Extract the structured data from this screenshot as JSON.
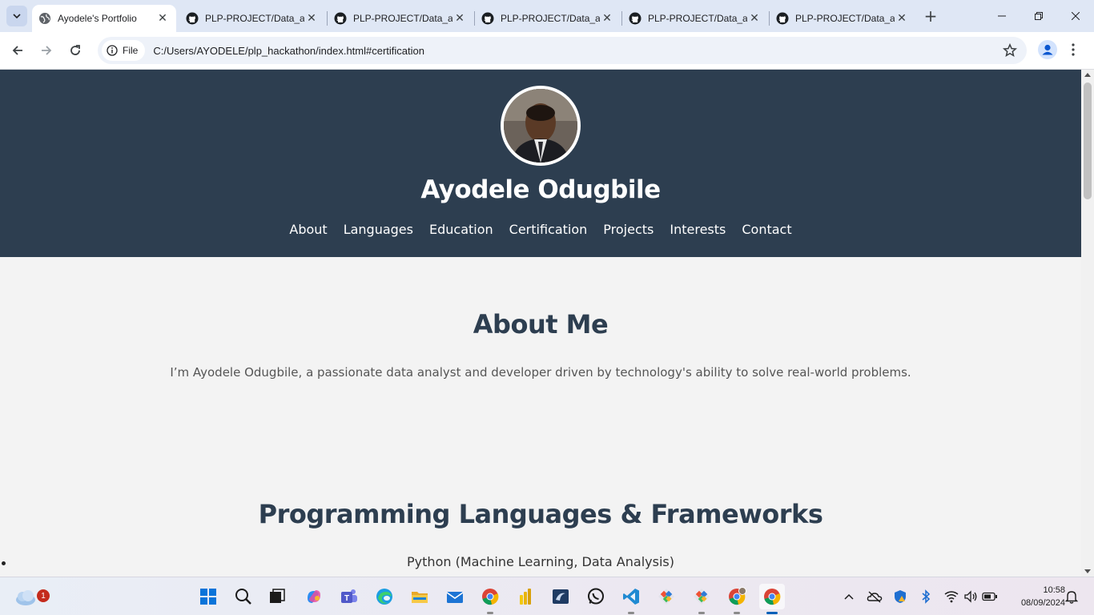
{
  "browser": {
    "tabs": [
      {
        "title": "Ayodele's Portfolio",
        "favicon": "globe-icon",
        "active": true
      },
      {
        "title": "PLP-PROJECT/Data_a",
        "favicon": "github-icon",
        "active": false
      },
      {
        "title": "PLP-PROJECT/Data_a",
        "favicon": "github-icon",
        "active": false
      },
      {
        "title": "PLP-PROJECT/Data_a",
        "favicon": "github-icon",
        "active": false
      },
      {
        "title": "PLP-PROJECT/Data_a",
        "favicon": "github-icon",
        "active": false
      },
      {
        "title": "PLP-PROJECT/Data_a",
        "favicon": "github-icon",
        "active": false
      }
    ],
    "address": {
      "scheme_chip": "File",
      "url": "C:/Users/AYODELE/plp_hackathon/index.html#certification"
    }
  },
  "page": {
    "header": {
      "name": "Ayodele Odugbile",
      "nav": [
        "About",
        "Languages",
        "Education",
        "Certification",
        "Projects",
        "Interests",
        "Contact"
      ],
      "bg_color": "#2d3e50"
    },
    "about": {
      "title": "About Me",
      "text": "I’m Ayodele Odugbile, a passionate data analyst and developer driven by technology's ability to solve real-world problems."
    },
    "languages": {
      "title": "Programming Languages & Frameworks",
      "items": [
        "Python (Machine Learning, Data Analysis)"
      ]
    }
  },
  "taskbar": {
    "weather_badge": "1",
    "time": "10:58",
    "date": "08/09/2024",
    "pinned": [
      "windows-start-icon",
      "search-icon",
      "task-view-icon",
      "copilot-icon",
      "teams-icon",
      "edge-icon",
      "file-explorer-icon",
      "mail-icon",
      "chrome-icon",
      "power-bi-icon",
      "sql-server-icon",
      "whatsapp-icon",
      "vscode-icon",
      "git-icon",
      "git-icon",
      "chrome-profile-icon",
      "chrome-icon"
    ],
    "tray": [
      "chevron-up-icon",
      "onedrive-off-icon",
      "security-icon",
      "bluetooth-icon",
      "wifi-icon",
      "volume-icon",
      "battery-icon",
      "notification-bell-icon"
    ]
  }
}
